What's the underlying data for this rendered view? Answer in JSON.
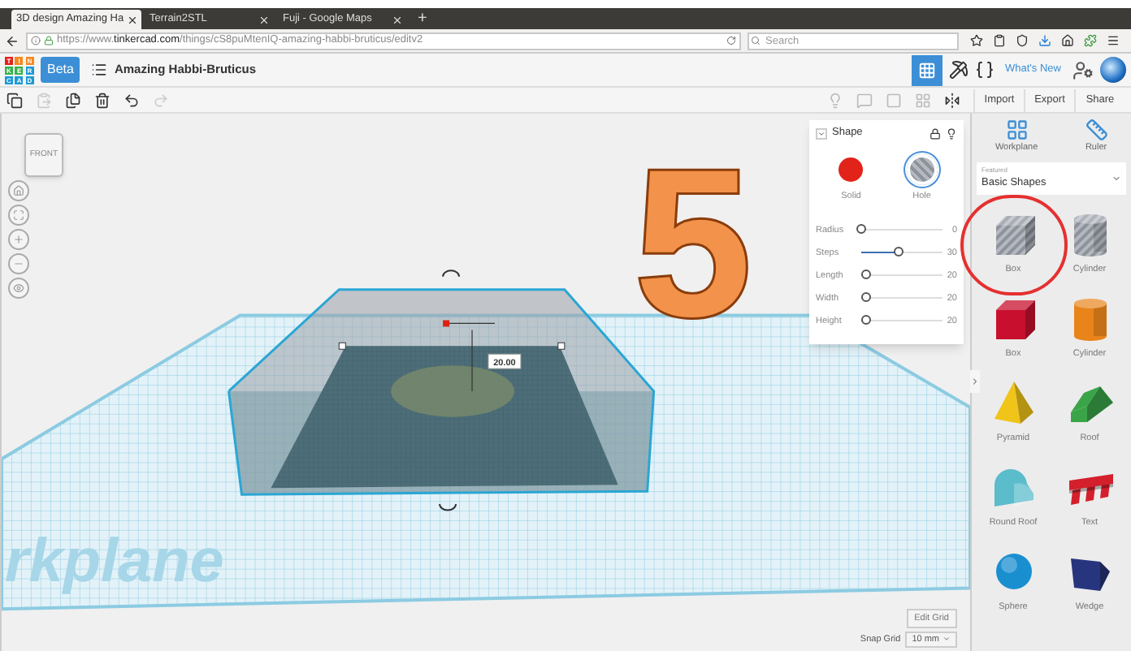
{
  "browser": {
    "tabs": [
      {
        "title": "3D design Amazing Ha",
        "selected": true
      },
      {
        "title": "Terrain2STL",
        "selected": false
      },
      {
        "title": "Fuji - Google Maps",
        "selected": false
      }
    ],
    "new_tab": "+",
    "url": {
      "prefix": "https://www.",
      "domain": "tinkercad.com",
      "path": "/things/cS8puMtenIQ-amazing-habbi-bruticus/editv2"
    },
    "search": {
      "placeholder": "Search"
    }
  },
  "header": {
    "logo_letters": [
      "T",
      "I",
      "N",
      "K",
      "E",
      "R",
      "C",
      "A",
      "D"
    ],
    "badge": "Beta",
    "title": "Amazing Habbi-Bruticus",
    "whats_new": "What's New"
  },
  "toolbar": {
    "tools": [
      {
        "kind": "copy",
        "disabled": false
      },
      {
        "kind": "paste",
        "disabled": true
      },
      {
        "kind": "duplicate",
        "disabled": false
      },
      {
        "kind": "delete",
        "disabled": false
      },
      {
        "kind": "undo",
        "disabled": false
      },
      {
        "kind": "redo",
        "disabled": true
      }
    ],
    "buttons": [
      "Import",
      "Export",
      "Share"
    ]
  },
  "viewport": {
    "view_cube": "FRONT",
    "dimension": "20.00",
    "workplane_label": "rkplane",
    "shape_label": "5",
    "edit_grid": "Edit Grid",
    "snap_grid": {
      "label": "Snap Grid",
      "value": "10 mm"
    }
  },
  "inspector": {
    "title": "Shape",
    "modes": [
      {
        "kind": "solid",
        "label": "Solid",
        "selected": false
      },
      {
        "kind": "hole",
        "label": "Hole",
        "selected": true
      }
    ],
    "params": [
      {
        "label": "Radius",
        "value": "0",
        "level": 0.0
      },
      {
        "label": "Steps",
        "value": "30",
        "level": 0.45
      },
      {
        "label": "Length",
        "value": "20",
        "level": 0.05
      },
      {
        "label": "Width",
        "value": "20",
        "level": 0.05
      },
      {
        "label": "Height",
        "value": "20",
        "level": 0.05
      }
    ]
  },
  "library": {
    "tools": [
      {
        "kind": "workplane",
        "label": "Workplane"
      },
      {
        "kind": "ruler",
        "label": "Ruler"
      }
    ],
    "category": {
      "label": "Featured",
      "value": "Basic Shapes"
    },
    "shapes": [
      {
        "kind": "box",
        "label": "Box",
        "color": "#b4b8c0",
        "hole": true,
        "highlighted": true
      },
      {
        "kind": "cylinder",
        "label": "Cylinder",
        "color": "#b4b8c0",
        "hole": true,
        "highlighted": false
      },
      {
        "kind": "box",
        "label": "Box",
        "color": "#c8102e",
        "hole": false,
        "highlighted": false
      },
      {
        "kind": "cylinder",
        "label": "Cylinder",
        "color": "#e8841a",
        "hole": false,
        "highlighted": false
      },
      {
        "kind": "pyramid",
        "label": "Pyramid",
        "color": "#f0c419",
        "highlighted": false
      },
      {
        "kind": "roof",
        "label": "Roof",
        "color": "#3aa548",
        "highlighted": false
      },
      {
        "kind": "roundroof",
        "label": "Round Roof",
        "color": "#5bbccc",
        "highlighted": false
      },
      {
        "kind": "text",
        "label": "Text",
        "color": "#d4202c",
        "highlighted": false
      },
      {
        "kind": "sphere",
        "label": "Sphere",
        "color": "#1a8fd0",
        "highlighted": false
      },
      {
        "kind": "wedge",
        "label": "Wedge",
        "color": "#27357e",
        "highlighted": false
      }
    ]
  }
}
